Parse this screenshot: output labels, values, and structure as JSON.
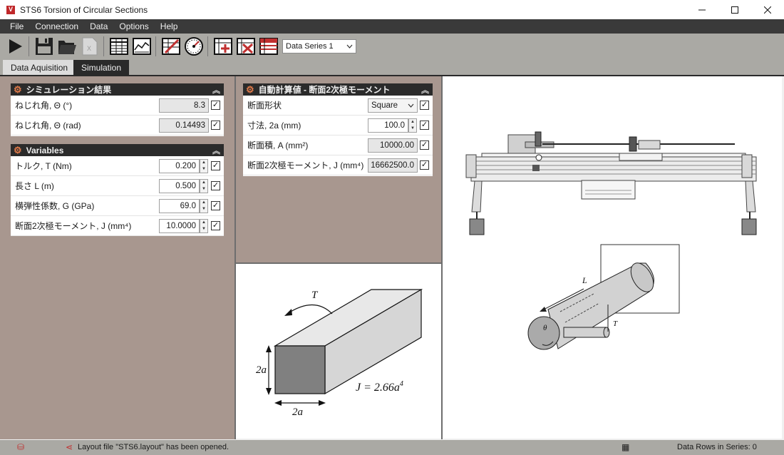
{
  "window": {
    "title": "STS6 Torsion of Circular Sections",
    "app_icon_text": "V"
  },
  "menu": [
    "File",
    "Connection",
    "Data",
    "Options",
    "Help"
  ],
  "toolbar": {
    "series_select": "Data Series 1"
  },
  "tabs": [
    {
      "label": "Data Aquisition",
      "active": false
    },
    {
      "label": "Simulation",
      "active": true
    }
  ],
  "sim_results": {
    "title": "シミュレーション結果",
    "rows": [
      {
        "label": "ねじれ角, Θ (°)",
        "value": "8.3"
      },
      {
        "label": "ねじれ角, Θ (rad)",
        "value": "0.14493"
      }
    ]
  },
  "variables": {
    "title": "Variables",
    "rows": [
      {
        "label": "トルク, T (Nm)",
        "value": "0.200"
      },
      {
        "label": "長さ L (m)",
        "value": "0.500"
      },
      {
        "label": "横弾性係数, G (GPa)",
        "value": "69.0"
      },
      {
        "label": "断面2次極モーメント, J (mm⁴)",
        "value": "10.0000"
      }
    ]
  },
  "auto_calc": {
    "title": "自動計算値 - 断面2次極モーメント",
    "rows": [
      {
        "label": "断面形状",
        "value": "Square"
      },
      {
        "label": "寸法, 2a (mm)",
        "value": "100.0"
      },
      {
        "label": "断面積, A (mm²)",
        "value": "10000.00"
      },
      {
        "label": "断面2次極モーメント, J (mm⁴)",
        "value": "16662500.0"
      }
    ]
  },
  "section_diagram": {
    "torque_label": "T",
    "height_label": "2a",
    "width_label": "2a",
    "formula": "J = 2.66a",
    "formula_exp": "4"
  },
  "rig_diagram": {
    "length_label": "L",
    "torque_label": "T",
    "angle_label": "θ"
  },
  "status": {
    "message": "Layout file \"STS6.layout\" has been opened.",
    "rows": "Data Rows in Series: 0"
  }
}
